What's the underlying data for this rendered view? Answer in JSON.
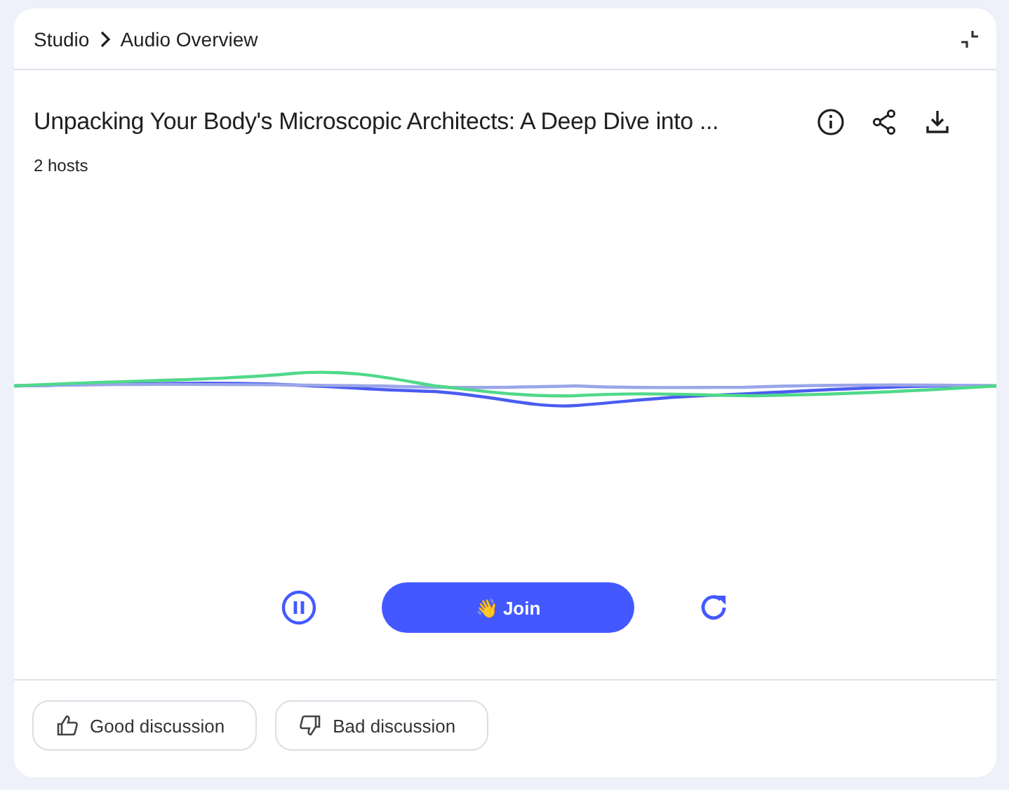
{
  "breadcrumb": [
    "Studio",
    "Audio Overview"
  ],
  "title": "Unpacking Your Body's Microscopic Architects: A Deep Dive into ...",
  "subtitle": "2 hosts",
  "player": {
    "playing": true,
    "join_label": "👋 Join"
  },
  "feedback": [
    "Good discussion",
    "Bad discussion"
  ]
}
